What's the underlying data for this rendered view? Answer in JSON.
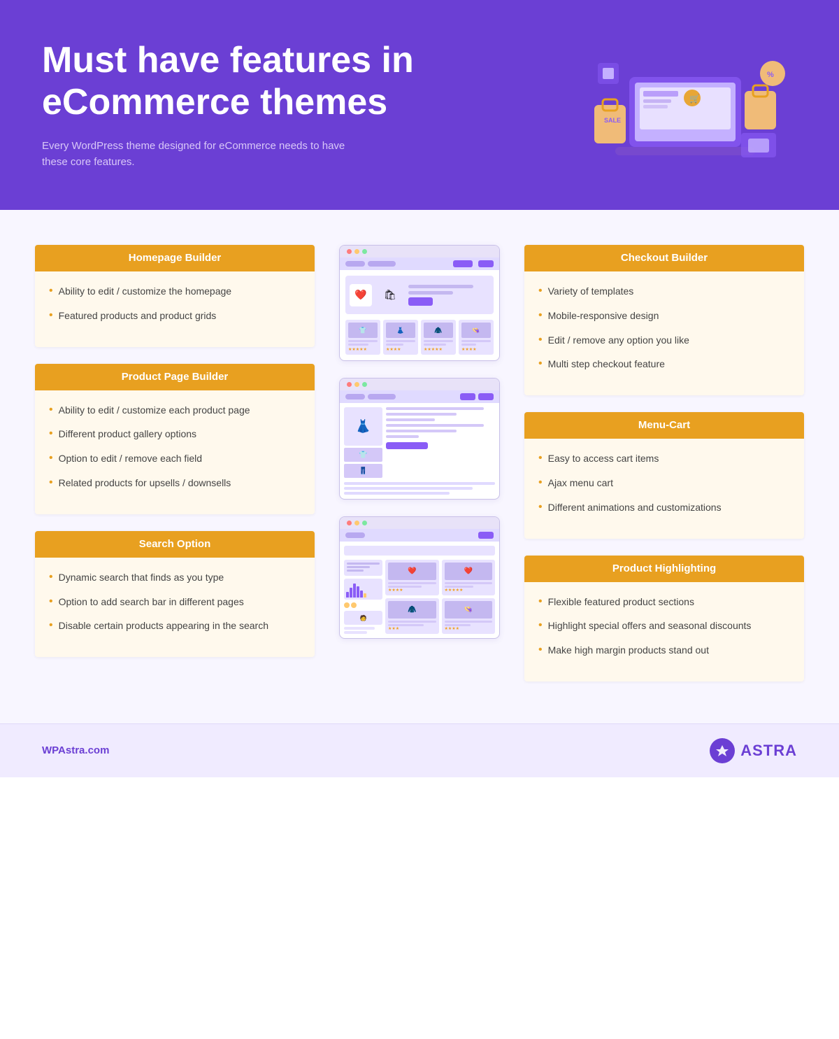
{
  "header": {
    "title": "Must have features in eCommerce themes",
    "subtitle": "Every WordPress theme designed for eCommerce needs to have these core features."
  },
  "features": {
    "homepage_builder": {
      "title": "Homepage Builder",
      "items": [
        "Ability to edit / customize the homepage",
        "Featured products and product grids"
      ]
    },
    "product_page_builder": {
      "title": "Product Page Builder",
      "items": [
        "Ability to edit / customize each product page",
        "Different product gallery options",
        "Option to edit / remove each field",
        "Related products for upsells / downsells"
      ]
    },
    "search_option": {
      "title": "Search Option",
      "items": [
        "Dynamic search that finds as you type",
        "Option to add search bar in different pages",
        "Disable certain products appearing in the search"
      ]
    },
    "checkout_builder": {
      "title": "Checkout Builder",
      "items": [
        "Variety of templates",
        "Mobile-responsive design",
        "Edit / remove any option you like",
        "Multi step checkout feature"
      ]
    },
    "menu_cart": {
      "title": "Menu-Cart",
      "items": [
        "Easy to access cart items",
        "Ajax menu cart",
        "Different animations and customizations"
      ]
    },
    "product_highlighting": {
      "title": "Product Highlighting",
      "items": [
        "Flexible featured product sections",
        "Highlight special offers and seasonal discounts",
        "Make high margin products stand out"
      ]
    }
  },
  "footer": {
    "url": "WPAstra.com",
    "brand": "ASTRA"
  }
}
